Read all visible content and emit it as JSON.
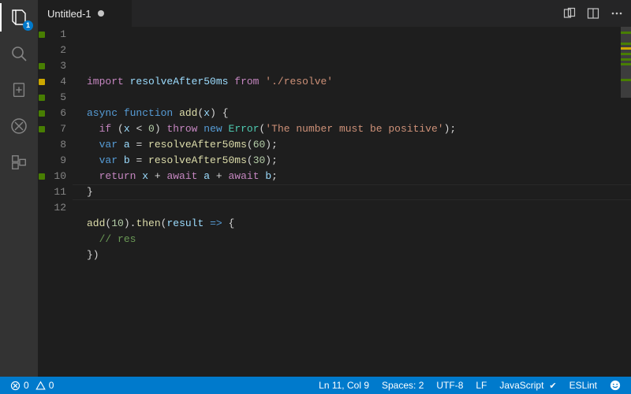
{
  "activity": {
    "explorer_badge": "1"
  },
  "tab": {
    "title": "Untitled-1"
  },
  "gutter_colors": {
    "green": "#487e02",
    "yellow": "#cca700"
  },
  "code": {
    "lines": [
      {
        "n": 1,
        "marker": "green",
        "tokens": [
          [
            "kw2",
            "import"
          ],
          [
            "pun",
            " "
          ],
          [
            "var",
            "resolveAfter50ms"
          ],
          [
            "pun",
            " "
          ],
          [
            "kw2",
            "from"
          ],
          [
            "pun",
            " "
          ],
          [
            "str",
            "'./resolve'"
          ]
        ]
      },
      {
        "n": 2,
        "marker": "",
        "tokens": []
      },
      {
        "n": 3,
        "marker": "green",
        "tokens": [
          [
            "kw",
            "async"
          ],
          [
            "pun",
            " "
          ],
          [
            "kw",
            "function"
          ],
          [
            "pun",
            " "
          ],
          [
            "fn",
            "add"
          ],
          [
            "pun",
            "("
          ],
          [
            "var",
            "x"
          ],
          [
            "pun",
            ") {"
          ]
        ]
      },
      {
        "n": 4,
        "marker": "yellow",
        "tokens": [
          [
            "pun",
            "  "
          ],
          [
            "kw2",
            "if"
          ],
          [
            "pun",
            " ("
          ],
          [
            "var",
            "x"
          ],
          [
            "pun",
            " < "
          ],
          [
            "num",
            "0"
          ],
          [
            "pun",
            ") "
          ],
          [
            "kw2",
            "throw"
          ],
          [
            "pun",
            " "
          ],
          [
            "kw",
            "new"
          ],
          [
            "pun",
            " "
          ],
          [
            "type",
            "Error"
          ],
          [
            "pun",
            "("
          ],
          [
            "str",
            "'The number must be positive'"
          ],
          [
            "pun",
            ");"
          ]
        ]
      },
      {
        "n": 5,
        "marker": "green",
        "tokens": [
          [
            "pun",
            "  "
          ],
          [
            "kw",
            "var"
          ],
          [
            "pun",
            " "
          ],
          [
            "var",
            "a"
          ],
          [
            "pun",
            " = "
          ],
          [
            "fn",
            "resolveAfter50ms"
          ],
          [
            "pun",
            "("
          ],
          [
            "num",
            "60"
          ],
          [
            "pun",
            ");"
          ]
        ]
      },
      {
        "n": 6,
        "marker": "green",
        "tokens": [
          [
            "pun",
            "  "
          ],
          [
            "kw",
            "var"
          ],
          [
            "pun",
            " "
          ],
          [
            "var",
            "b"
          ],
          [
            "pun",
            " = "
          ],
          [
            "fn",
            "resolveAfter50ms"
          ],
          [
            "pun",
            "("
          ],
          [
            "num",
            "30"
          ],
          [
            "pun",
            ");"
          ]
        ]
      },
      {
        "n": 7,
        "marker": "green",
        "tokens": [
          [
            "pun",
            "  "
          ],
          [
            "kw2",
            "return"
          ],
          [
            "pun",
            " "
          ],
          [
            "var",
            "x"
          ],
          [
            "pun",
            " + "
          ],
          [
            "kw2",
            "await"
          ],
          [
            "pun",
            " "
          ],
          [
            "var",
            "a"
          ],
          [
            "pun",
            " + "
          ],
          [
            "kw2",
            "await"
          ],
          [
            "pun",
            " "
          ],
          [
            "var",
            "b"
          ],
          [
            "pun",
            ";"
          ]
        ]
      },
      {
        "n": 8,
        "marker": "",
        "tokens": [
          [
            "pun",
            "}"
          ]
        ]
      },
      {
        "n": 9,
        "marker": "",
        "tokens": []
      },
      {
        "n": 10,
        "marker": "green",
        "tokens": [
          [
            "fn",
            "add"
          ],
          [
            "pun",
            "("
          ],
          [
            "num",
            "10"
          ],
          [
            "pun",
            ")."
          ],
          [
            "fn",
            "then"
          ],
          [
            "pun",
            "("
          ],
          [
            "var",
            "result"
          ],
          [
            "pun",
            " "
          ],
          [
            "kw",
            "=>"
          ],
          [
            "pun",
            " {"
          ]
        ]
      },
      {
        "n": 11,
        "marker": "",
        "tokens": [
          [
            "pun",
            "  "
          ],
          [
            "cmt",
            "// res"
          ]
        ],
        "current": true
      },
      {
        "n": 12,
        "marker": "",
        "tokens": [
          [
            "pun",
            "})"
          ]
        ]
      }
    ]
  },
  "status": {
    "errors": "0",
    "warnings": "0",
    "cursor": "Ln 11, Col 9",
    "spaces": "Spaces: 2",
    "encoding": "UTF-8",
    "eol": "LF",
    "language": "JavaScript",
    "eslint": "ESLint"
  }
}
